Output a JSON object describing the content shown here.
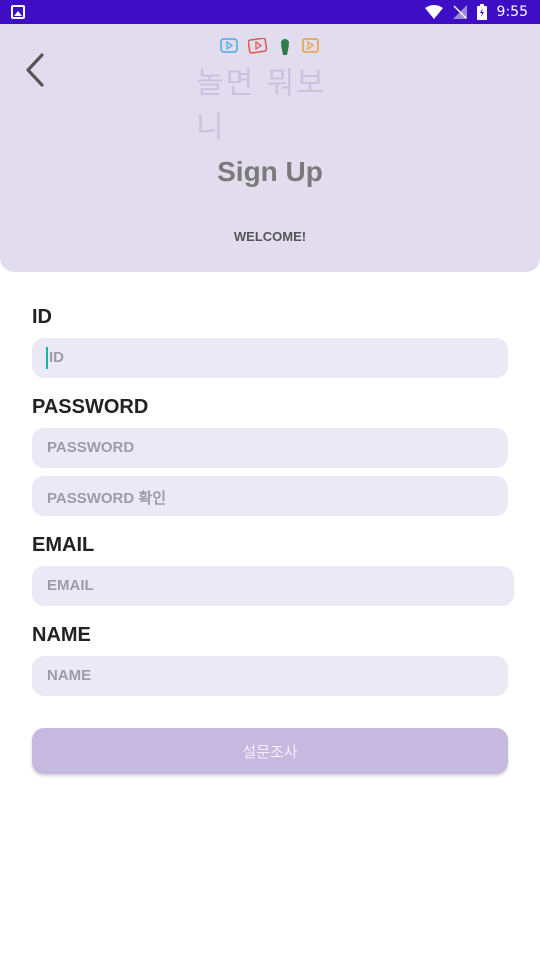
{
  "status_bar": {
    "time": "9:55",
    "icons": [
      "gallery-icon",
      "wifi-icon",
      "no-signal-icon",
      "battery-charging-icon"
    ]
  },
  "header": {
    "logo_text": "놀면 뭐보니",
    "title": "Sign Up",
    "subtitle": "WELCOME!"
  },
  "form": {
    "id_label": "ID",
    "id_placeholder": "ID",
    "password_label": "PASSWORD",
    "password_placeholder": "PASSWORD",
    "password_confirm_placeholder": "PASSWORD 확인",
    "email_label": "EMAIL",
    "email_placeholder": "EMAIL",
    "name_label": "NAME",
    "name_placeholder": "NAME",
    "submit_label": "설문조사"
  },
  "colors": {
    "status_bar": "#3d0ec4",
    "header_bg": "#e1ddee",
    "field_bg": "#ece9f6",
    "button_bg": "#c7b8df"
  }
}
